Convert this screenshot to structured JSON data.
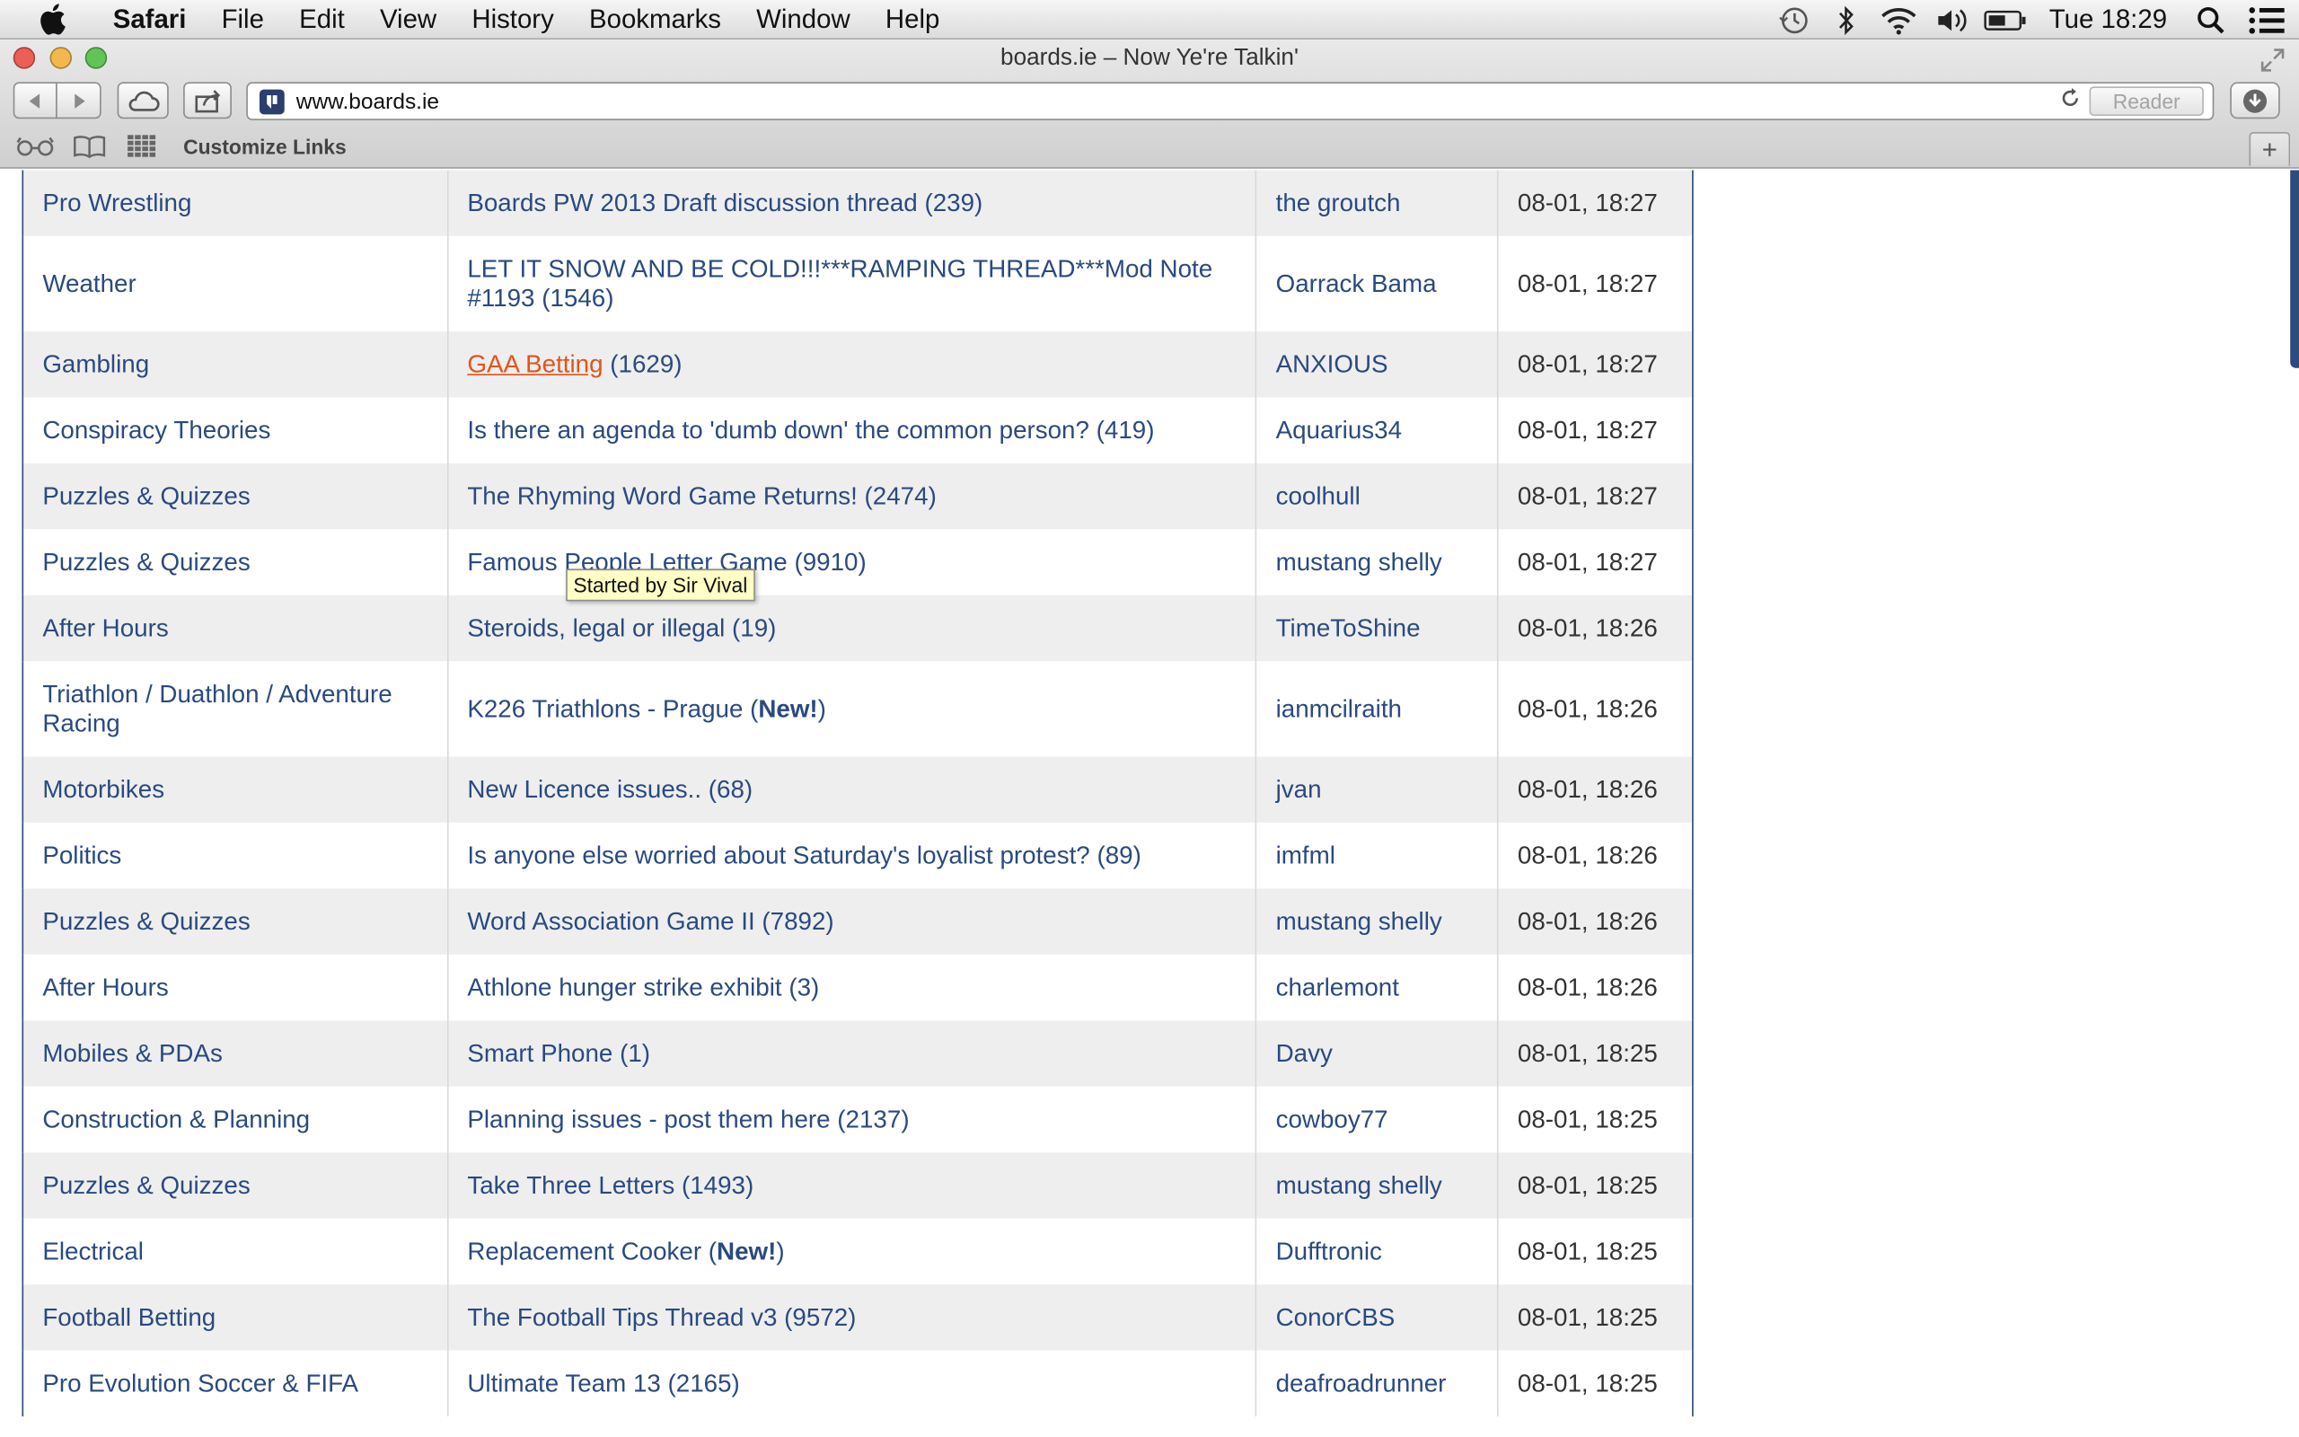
{
  "menubar": {
    "app": "Safari",
    "items": [
      "File",
      "Edit",
      "View",
      "History",
      "Bookmarks",
      "Window",
      "Help"
    ],
    "clock": "Tue 18:29"
  },
  "window": {
    "title": "boards.ie – Now Ye're Talkin'",
    "url": "www.boards.ie",
    "reader_label": "Reader",
    "bookmark_label": "Customize Links"
  },
  "tooltip": "Started by Sir Vival",
  "new_label": "New!",
  "rows": [
    {
      "forum": "Pro Wrestling",
      "thread": "Boards PW 2013 Draft discussion thread",
      "count": "239",
      "user": "the groutch",
      "time": "08-01, 18:27"
    },
    {
      "forum": "Weather",
      "thread": "LET IT SNOW AND BE COLD!!!***RAMPING THREAD***Mod Note #1193",
      "count": "1546",
      "user": "Oarrack Bama",
      "time": "08-01, 18:27"
    },
    {
      "forum": "Gambling",
      "thread": "GAA Betting",
      "count": "1629",
      "user": "ANXIOUS",
      "time": "08-01, 18:27"
    },
    {
      "forum": "Conspiracy Theories",
      "thread": "Is there an agenda to 'dumb down' the common person?",
      "count": "419",
      "user": "Aquarius34",
      "time": "08-01, 18:27"
    },
    {
      "forum": "Puzzles & Quizzes",
      "thread": "The Rhyming Word Game Returns!",
      "count": "2474",
      "user": "coolhull",
      "time": "08-01, 18:27"
    },
    {
      "forum": "Puzzles & Quizzes",
      "thread": "Famous People Letter Game",
      "count": "9910",
      "user": "mustang shelly",
      "time": "08-01, 18:27"
    },
    {
      "forum": "After Hours",
      "thread": "Steroids, legal or illegal",
      "count": "19",
      "user": "TimeToShine",
      "time": "08-01, 18:26"
    },
    {
      "forum": "Triathlon / Duathlon / Adventure Racing",
      "thread": "K226 Triathlons - Prague",
      "count": "",
      "user": "ianmcilraith",
      "time": "08-01, 18:26"
    },
    {
      "forum": "Motorbikes",
      "thread": "New Licence issues..",
      "count": "68",
      "user": "jvan",
      "time": "08-01, 18:26"
    },
    {
      "forum": "Politics",
      "thread": "Is anyone else worried about Saturday's loyalist protest?",
      "count": "89",
      "user": "imfml",
      "time": "08-01, 18:26"
    },
    {
      "forum": "Puzzles & Quizzes",
      "thread": "Word Association Game II",
      "count": "7892",
      "user": "mustang shelly",
      "time": "08-01, 18:26"
    },
    {
      "forum": "After Hours",
      "thread": "Athlone hunger strike exhibit",
      "count": "3",
      "user": "charlemont",
      "time": "08-01, 18:26"
    },
    {
      "forum": "Mobiles & PDAs",
      "thread": "Smart Phone",
      "count": "1",
      "user": "Davy",
      "time": "08-01, 18:25"
    },
    {
      "forum": "Construction & Planning",
      "thread": "Planning issues - post them here",
      "count": "2137",
      "user": "cowboy77",
      "time": "08-01, 18:25"
    },
    {
      "forum": "Puzzles & Quizzes",
      "thread": "Take Three Letters",
      "count": "1493",
      "user": "mustang shelly",
      "time": "08-01, 18:25"
    },
    {
      "forum": "Electrical",
      "thread": "Replacement Cooker",
      "count": "",
      "user": "Dufftronic",
      "time": "08-01, 18:25"
    },
    {
      "forum": "Football Betting",
      "thread": "The Football Tips Thread v3",
      "count": "9572",
      "user": "ConorCBS",
      "time": "08-01, 18:25"
    },
    {
      "forum": "Pro Evolution Soccer & FIFA",
      "thread": "Ultimate Team 13",
      "count": "2165",
      "user": "deafroadrunner",
      "time": "08-01, 18:25"
    }
  ]
}
